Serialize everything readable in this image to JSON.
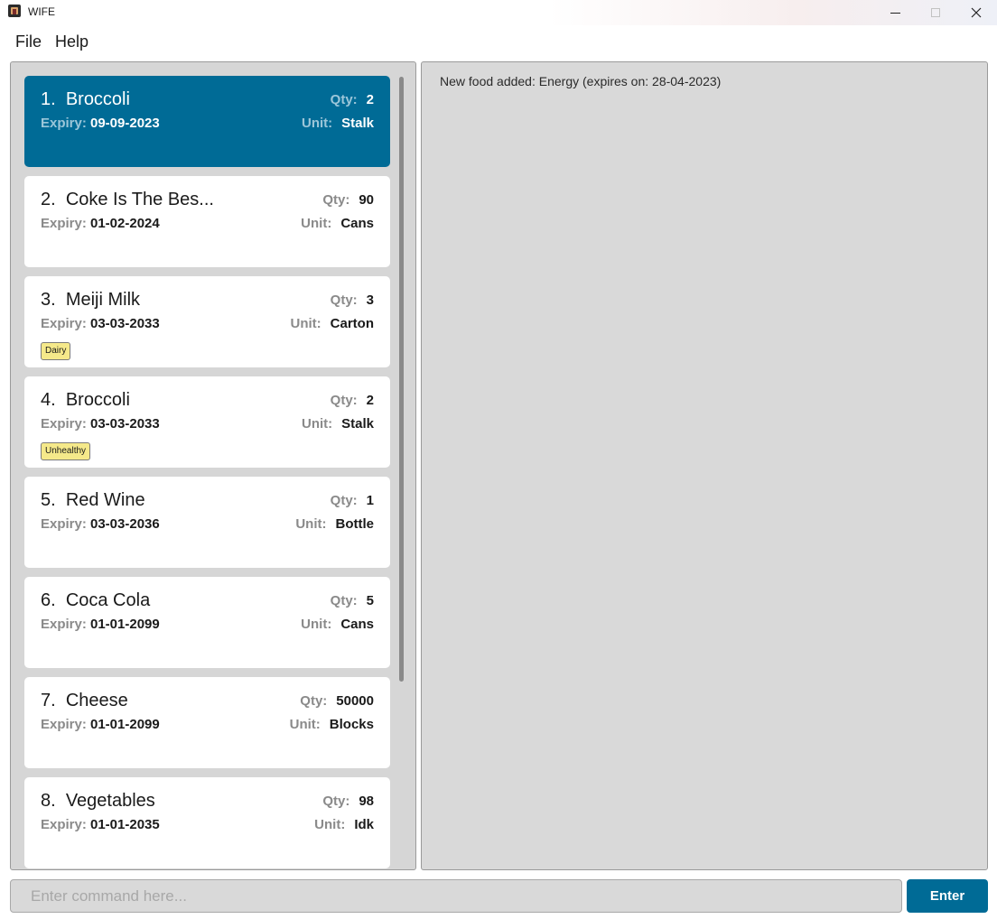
{
  "window": {
    "title": "WIFE",
    "controls": [
      "minimize-icon",
      "maximize-icon",
      "close-icon"
    ]
  },
  "menu": {
    "file": "File",
    "help": "Help"
  },
  "foods": [
    {
      "index": "1.",
      "name": "Broccoli",
      "qty": "2",
      "expiry": "09-09-2023",
      "unit": "Stalk",
      "tag": ""
    },
    {
      "index": "2.",
      "name": "Coke Is The Bes...",
      "qty": "90",
      "expiry": "01-02-2024",
      "unit": "Cans",
      "tag": ""
    },
    {
      "index": "3.",
      "name": "Meiji Milk",
      "qty": "3",
      "expiry": "03-03-2033",
      "unit": "Carton",
      "tag": "Dairy"
    },
    {
      "index": "4.",
      "name": "Broccoli",
      "qty": "2",
      "expiry": "03-03-2033",
      "unit": "Stalk",
      "tag": "Unhealthy"
    },
    {
      "index": "5.",
      "name": "Red Wine",
      "qty": "1",
      "expiry": "03-03-2036",
      "unit": "Bottle",
      "tag": ""
    },
    {
      "index": "6.",
      "name": "Coca Cola",
      "qty": "5",
      "expiry": "01-01-2099",
      "unit": "Cans",
      "tag": ""
    },
    {
      "index": "7.",
      "name": "Cheese",
      "qty": "50000",
      "expiry": "01-01-2099",
      "unit": "Blocks",
      "tag": ""
    },
    {
      "index": "8.",
      "name": "Vegetables",
      "qty": "98",
      "expiry": "01-01-2035",
      "unit": "Idk",
      "tag": ""
    }
  ],
  "labels": {
    "qty": "Qty:",
    "expiry": "Expiry:",
    "unit": "Unit:"
  },
  "result": {
    "message": "New food added: Energy (expires on: 28-04-2023)"
  },
  "command": {
    "placeholder": "Enter command here...",
    "value": "",
    "enter_label": "Enter"
  },
  "colors": {
    "accent": "#006b96",
    "tag_background": "#f5e98a",
    "panel_background": "#d6d6d6"
  }
}
